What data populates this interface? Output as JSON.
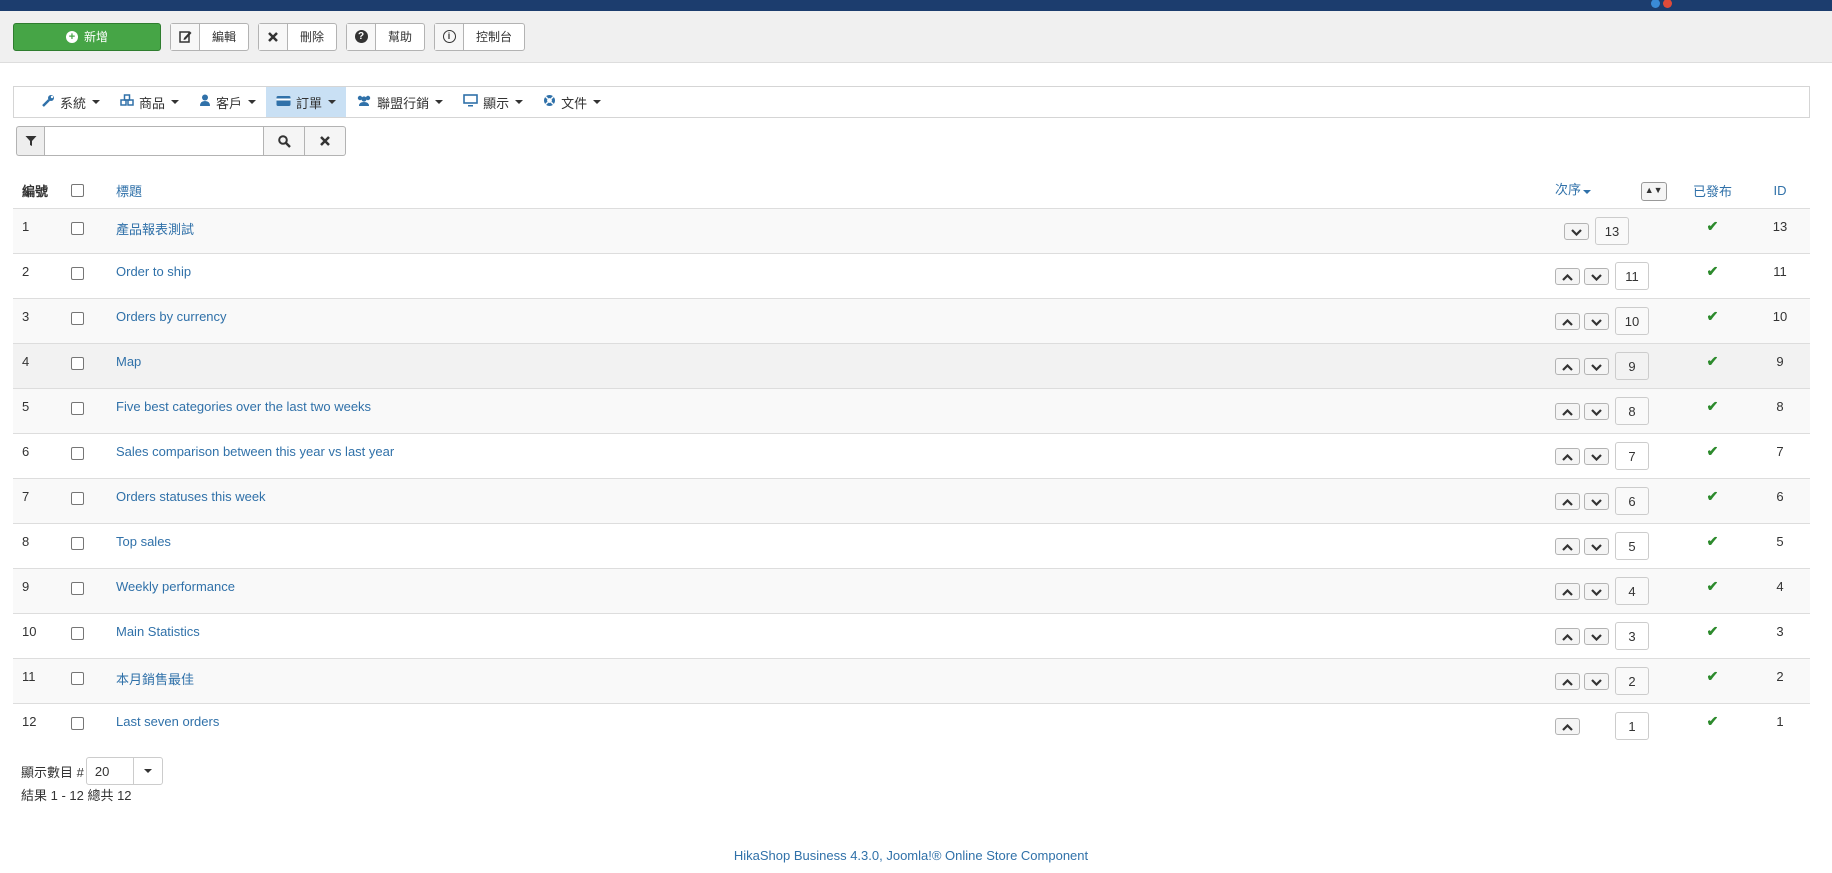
{
  "toolbar": {
    "new_label": "新增",
    "edit_label": "編輯",
    "delete_label": "刪除",
    "help_label": "幫助",
    "dashboard_label": "控制台"
  },
  "menu": {
    "items": [
      {
        "label": "系統",
        "icon": "wrench-icon"
      },
      {
        "label": "商品",
        "icon": "cubes-icon"
      },
      {
        "label": "客戶",
        "icon": "user-icon"
      },
      {
        "label": "訂單",
        "icon": "credit-card-icon",
        "active": true
      },
      {
        "label": "聯盟行銷",
        "icon": "users-icon"
      },
      {
        "label": "顯示",
        "icon": "monitor-icon"
      },
      {
        "label": "文件",
        "icon": "lifesaver-icon"
      }
    ]
  },
  "search": {
    "value": "",
    "placeholder": ""
  },
  "table": {
    "headers": {
      "num": "編號",
      "title": "標題",
      "order": "次序",
      "published": "已發布",
      "id": "ID"
    },
    "rows": [
      {
        "num": "1",
        "title": "產品報表測試",
        "order": "13",
        "id": "13",
        "up": false,
        "down": true
      },
      {
        "num": "2",
        "title": "Order to ship",
        "order": "11",
        "id": "11",
        "up": true,
        "down": true
      },
      {
        "num": "3",
        "title": "Orders by currency",
        "order": "10",
        "id": "10",
        "up": true,
        "down": true
      },
      {
        "num": "4",
        "title": "Map",
        "order": "9",
        "id": "9",
        "up": true,
        "down": true
      },
      {
        "num": "5",
        "title": "Five best categories over the last two weeks",
        "order": "8",
        "id": "8",
        "up": true,
        "down": true
      },
      {
        "num": "6",
        "title": "Sales comparison between this year vs last year",
        "order": "7",
        "id": "7",
        "up": true,
        "down": true
      },
      {
        "num": "7",
        "title": "Orders statuses this week",
        "order": "6",
        "id": "6",
        "up": true,
        "down": true
      },
      {
        "num": "8",
        "title": "Top sales",
        "order": "5",
        "id": "5",
        "up": true,
        "down": true
      },
      {
        "num": "9",
        "title": "Weekly performance",
        "order": "4",
        "id": "4",
        "up": true,
        "down": true
      },
      {
        "num": "10",
        "title": "Main Statistics",
        "order": "3",
        "id": "3",
        "up": true,
        "down": true
      },
      {
        "num": "11",
        "title": "本月銷售最佳",
        "order": "2",
        "id": "2",
        "up": true,
        "down": true
      },
      {
        "num": "12",
        "title": "Last seven orders",
        "order": "1",
        "id": "1",
        "up": true,
        "down": false
      }
    ]
  },
  "pagination": {
    "limit_label": "顯示數目 #",
    "limit_value": "20",
    "result_text": "結果 1 - 12 總共 12"
  },
  "footer": {
    "credit": "HikaShop Business 4.3.0, Joomla!® Online Store Component"
  },
  "colors": {
    "accent": "#3071a9",
    "new_button": "#46a546",
    "topbar": "#1c3d6e",
    "published": "#2c8a2c"
  }
}
